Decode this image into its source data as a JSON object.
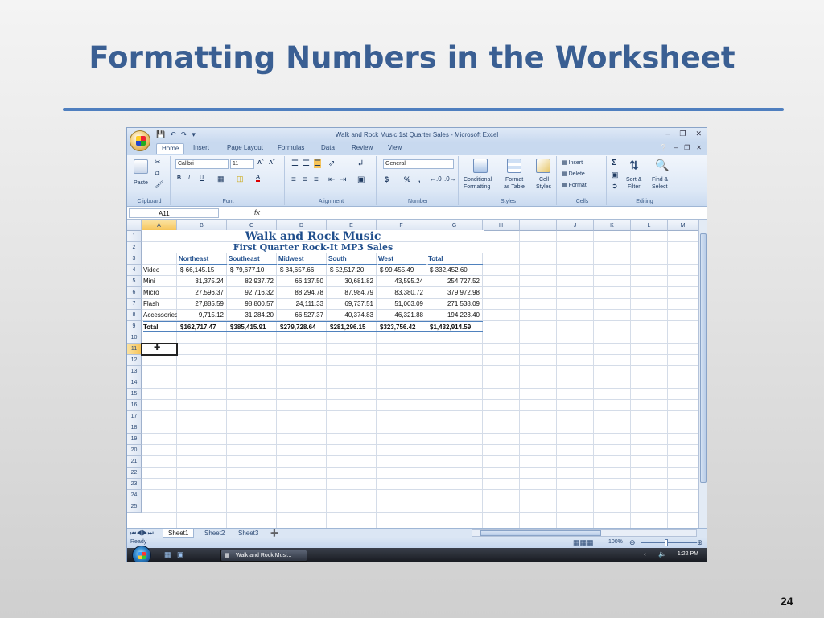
{
  "slide": {
    "title": "Formatting Numbers in the Worksheet",
    "number": "24"
  },
  "excel": {
    "window_title": "Walk and Rock Music 1st Quarter Sales - Microsoft Excel",
    "tabs": [
      "Home",
      "Insert",
      "Page Layout",
      "Formulas",
      "Data",
      "Review",
      "View"
    ],
    "ribbon": {
      "clipboard": {
        "label": "Clipboard",
        "paste": "Paste"
      },
      "font": {
        "label": "Font",
        "name": "Calibri",
        "size": "11"
      },
      "alignment": {
        "label": "Alignment"
      },
      "number": {
        "label": "Number",
        "format": "General",
        "currency": "$",
        "percent": "%"
      },
      "styles": {
        "label": "Styles",
        "conditional": "Conditional",
        "conditional2": "Formatting",
        "format_table": "Format",
        "format_table2": "as Table",
        "cell_styles": "Cell",
        "cell_styles2": "Styles"
      },
      "cells": {
        "label": "Cells",
        "insert": "Insert",
        "delete": "Delete",
        "format": "Format"
      },
      "editing": {
        "label": "Editing",
        "sort": "Sort &",
        "sort2": "Filter",
        "find": "Find &",
        "find2": "Select"
      }
    },
    "name_box": "A11",
    "fx": "fx",
    "columns": [
      "A",
      "B",
      "C",
      "D",
      "E",
      "F",
      "G",
      "H",
      "I",
      "J",
      "K",
      "L",
      "M"
    ],
    "rows": [
      "1",
      "2",
      "3",
      "4",
      "5",
      "6",
      "7",
      "8",
      "9",
      "10",
      "11",
      "12",
      "13",
      "14",
      "15",
      "16",
      "17",
      "18",
      "19",
      "20",
      "21",
      "22",
      "23",
      "24",
      "25"
    ],
    "sheet": {
      "title": "Walk and Rock Music",
      "subtitle": "First Quarter Rock-It MP3 Sales",
      "headers": [
        "Northeast",
        "Southeast",
        "Midwest",
        "South",
        "West",
        "Total"
      ],
      "data": [
        {
          "label": "Video",
          "values": [
            "$ 66,145.15",
            "$ 79,677.10",
            "$ 34,657.66",
            "$ 52,517.20",
            "$ 99,455.49",
            "$ 332,452.60"
          ]
        },
        {
          "label": "Mini",
          "values": [
            "31,375.24",
            "82,937.72",
            "66,137.50",
            "30,681.82",
            "43,595.24",
            "254,727.52"
          ]
        },
        {
          "label": "Micro",
          "values": [
            "27,596.37",
            "92,716.32",
            "88,294.78",
            "87,984.79",
            "83,380.72",
            "379,972.98"
          ]
        },
        {
          "label": "Flash",
          "values": [
            "27,885.59",
            "98,800.57",
            "24,111.33",
            "69,737.51",
            "51,003.09",
            "271,538.09"
          ]
        },
        {
          "label": "Accessories",
          "values": [
            "9,715.12",
            "31,284.20",
            "66,527.37",
            "40,374.83",
            "46,321.88",
            "194,223.40"
          ]
        }
      ],
      "total": {
        "label": "Total",
        "values": [
          "$162,717.47",
          "$385,415.91",
          "$279,728.64",
          "$281,296.15",
          "$323,756.42",
          "$1,432,914.59"
        ]
      }
    },
    "sheet_tabs": [
      "Sheet1",
      "Sheet2",
      "Sheet3"
    ],
    "status": {
      "ready": "Ready",
      "zoom": "100%"
    },
    "taskbar": {
      "task": "Walk and Rock Musi...",
      "clock": "1:22 PM"
    }
  }
}
